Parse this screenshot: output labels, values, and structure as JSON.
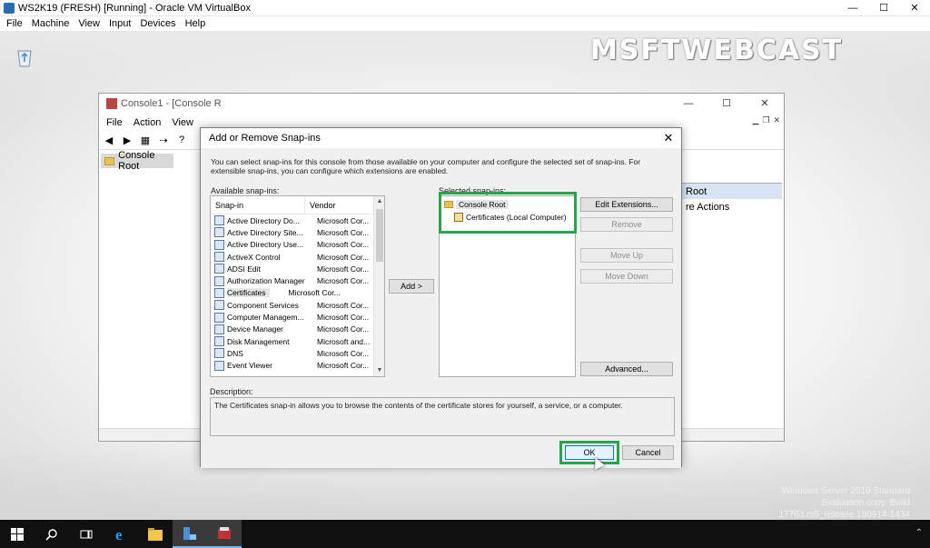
{
  "host": {
    "title": "WS2K19 (FRESH) [Running] - Oracle VM VirtualBox",
    "menu": [
      "File",
      "Machine",
      "View",
      "Input",
      "Devices",
      "Help"
    ],
    "controls": {
      "minimize": "—",
      "maximize": "☐",
      "close": "✕"
    }
  },
  "desktop": {
    "watermark": "MSFTWEBCAST",
    "license_lines": [
      "Windows Server 2019 Standard",
      "Evaluation copy. Build 17763.rs5_release.180914-1434"
    ]
  },
  "console": {
    "title": "Console1 - [Console R",
    "menu": [
      "File",
      "Action",
      "View"
    ],
    "tree_root": "Console Root",
    "actions_header": "Root",
    "actions_item": "re Actions"
  },
  "dialog": {
    "title": "Add or Remove Snap-ins",
    "intro": "You can select snap-ins for this console from those available on your computer and configure the selected set of snap-ins. For extensible snap-ins, you can configure which extensions are enabled.",
    "available_label": "Available snap-ins:",
    "columns": {
      "snapin": "Snap-in",
      "vendor": "Vendor"
    },
    "available": [
      {
        "name": "Active Directory Do...",
        "vendor": "Microsoft Cor...",
        "icon": "ad-domains-icon"
      },
      {
        "name": "Active Directory Site...",
        "vendor": "Microsoft Cor...",
        "icon": "ad-sites-icon"
      },
      {
        "name": "Active Directory Use...",
        "vendor": "Microsoft Cor...",
        "icon": "ad-users-icon"
      },
      {
        "name": "ActiveX Control",
        "vendor": "Microsoft Cor...",
        "icon": "activex-icon"
      },
      {
        "name": "ADSI Edit",
        "vendor": "Microsoft Cor...",
        "icon": "adsi-edit-icon"
      },
      {
        "name": "Authorization Manager",
        "vendor": "Microsoft Cor...",
        "icon": "authorization-icon"
      },
      {
        "name": "Certificates",
        "vendor": "Microsoft Cor...",
        "icon": "certificates-icon"
      },
      {
        "name": "Component Services",
        "vendor": "Microsoft Cor...",
        "icon": "component-services-icon"
      },
      {
        "name": "Computer Managem...",
        "vendor": "Microsoft Cor...",
        "icon": "computer-management-icon"
      },
      {
        "name": "Device Manager",
        "vendor": "Microsoft Cor...",
        "icon": "device-manager-icon"
      },
      {
        "name": "Disk Management",
        "vendor": "Microsoft and...",
        "icon": "disk-management-icon"
      },
      {
        "name": "DNS",
        "vendor": "Microsoft Cor...",
        "icon": "dns-icon"
      },
      {
        "name": "Event Viewer",
        "vendor": "Microsoft Cor...",
        "icon": "event-viewer-icon"
      }
    ],
    "add_button": "Add >",
    "selected_label": "Selected snap-ins:",
    "selected_root": "Console Root",
    "selected_child": "Certificates (Local Computer)",
    "buttons": {
      "edit_extensions": "Edit Extensions...",
      "remove": "Remove",
      "move_up": "Move Up",
      "move_down": "Move Down",
      "advanced": "Advanced...",
      "ok": "OK",
      "cancel": "Cancel"
    },
    "description_label": "Description:",
    "description": "The Certificates snap-in allows you to browse the contents of the certificate stores for yourself, a service, or a computer."
  },
  "taskbar": {
    "items": [
      "start-icon",
      "search-icon",
      "task-view-icon",
      "internet-explorer-icon",
      "file-explorer-icon",
      "server-manager-icon",
      "mmc-icon"
    ]
  },
  "colors": {
    "highlight": "#2aa44a",
    "taskbar": "#101010",
    "dialog_bg": "#f0f0f0"
  }
}
